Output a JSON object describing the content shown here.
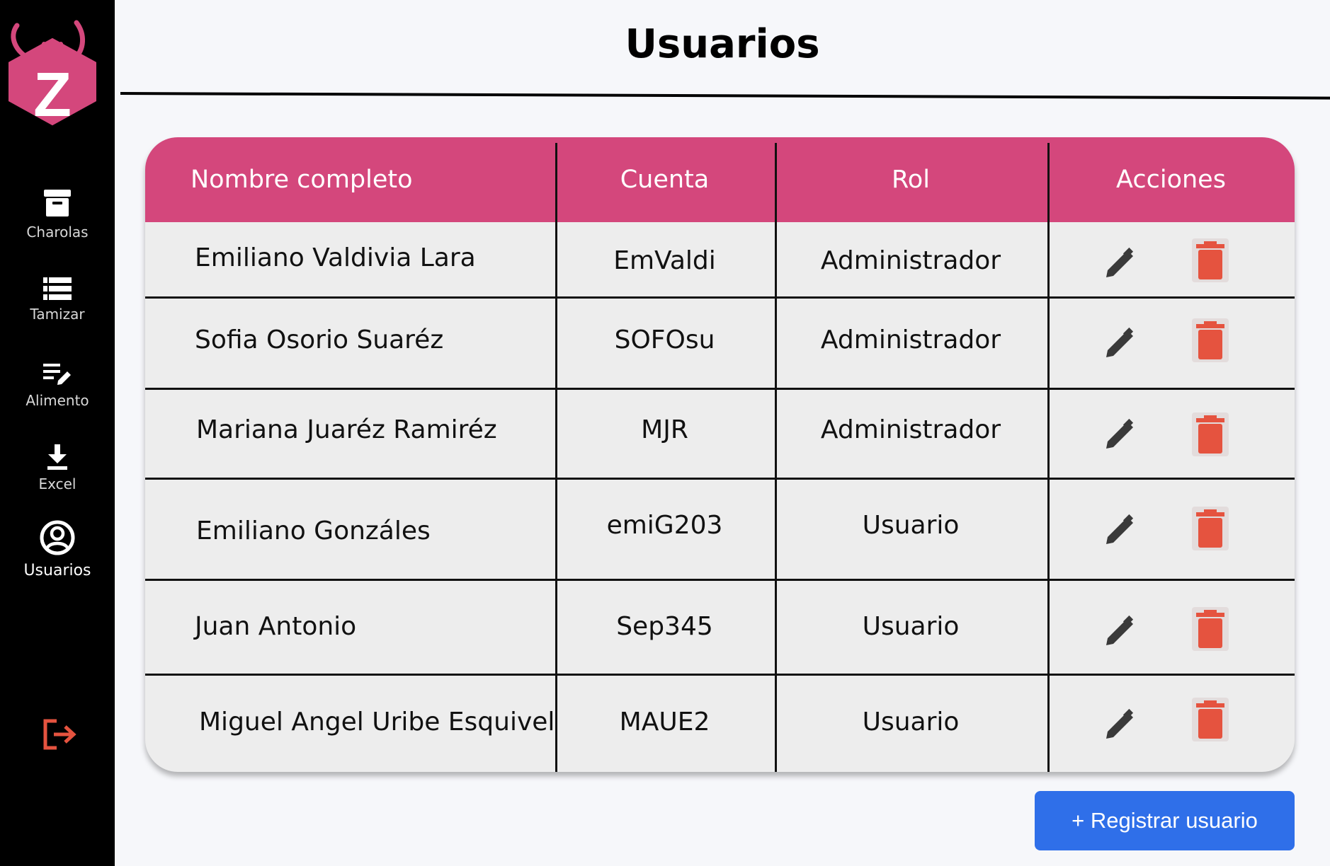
{
  "app": {
    "logo_icon": "z-bug-logo",
    "brand_color": "#d4477c"
  },
  "sidebar": {
    "items": [
      {
        "label": "Charolas",
        "icon": "archive-box-icon"
      },
      {
        "label": "Tamizar",
        "icon": "list-rows-icon"
      },
      {
        "label": "Alimento",
        "icon": "edit-list-icon"
      },
      {
        "label": "Excel",
        "icon": "download-icon"
      },
      {
        "label": "Usuarios",
        "icon": "user-circle-icon",
        "active": true
      }
    ],
    "logout_icon": "logout-icon"
  },
  "page": {
    "title": "Usuarios"
  },
  "table": {
    "headers": [
      "Nombre completo",
      "Cuenta",
      "Rol",
      "Acciones"
    ],
    "rows": [
      {
        "name": "Emiliano Valdivia Lara",
        "account": "EmValdi",
        "role": "Administrador"
      },
      {
        "name": "Sofia Osorio Suaréz",
        "account": "SOFOsu",
        "role": "Administrador"
      },
      {
        "name": "Mariana Juaréz Ramiréz",
        "account": "MJR",
        "role": "Administrador"
      },
      {
        "name": "Emiliano Gonzáles",
        "account": "emiG203",
        "role": "Usuario"
      },
      {
        "name": "Juan Antonio",
        "account": "Sep345",
        "role": "Usuario"
      },
      {
        "name": "Miguel Angel Uribe Esquivel",
        "account": "MAUE2",
        "role": "Usuario"
      }
    ],
    "action_icons": [
      "pencil-icon",
      "trash-icon"
    ],
    "delete_color": "#e5533f"
  },
  "actions": {
    "register_label": "+ Registrar usuario",
    "register_color": "#2f6fe9"
  }
}
